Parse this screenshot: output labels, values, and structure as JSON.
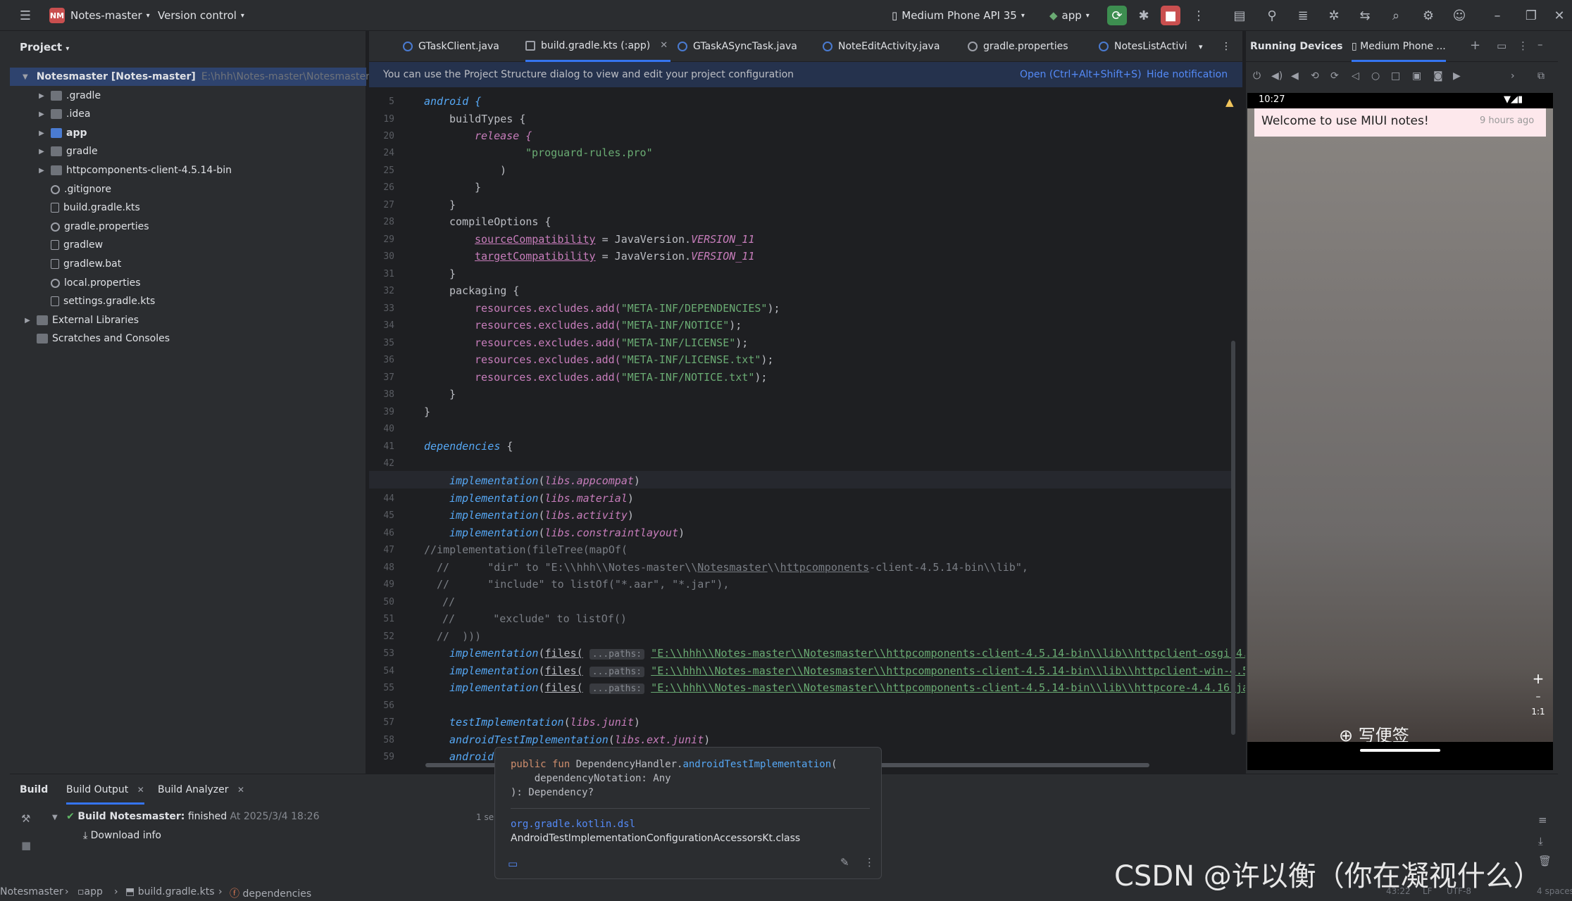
{
  "titlebar": {
    "project": "Notes-master",
    "project_badge": "NM",
    "vcs": "Version control",
    "device": "Medium Phone API 35",
    "run_config": "app"
  },
  "project_panel": {
    "title": "Project",
    "items": [
      {
        "label": "Notesmaster [Notes-master]",
        "hint": "E:\\hhh\\Notes-master\\Notesmaster"
      },
      {
        "label": ".gradle"
      },
      {
        "label": ".idea"
      },
      {
        "label": "app"
      },
      {
        "label": "gradle"
      },
      {
        "label": "httpcomponents-client-4.5.14-bin"
      },
      {
        "label": ".gitignore"
      },
      {
        "label": "build.gradle.kts"
      },
      {
        "label": "gradle.properties"
      },
      {
        "label": "gradlew"
      },
      {
        "label": "gradlew.bat"
      },
      {
        "label": "local.properties"
      },
      {
        "label": "settings.gradle.kts"
      },
      {
        "label": "External Libraries"
      },
      {
        "label": "Scratches and Consoles"
      }
    ]
  },
  "tabs": [
    {
      "label": "GTaskClient.java"
    },
    {
      "label": "build.gradle.kts (:app)"
    },
    {
      "label": "GTaskASyncTask.java"
    },
    {
      "label": "NoteEditActivity.java"
    },
    {
      "label": "gradle.properties"
    },
    {
      "label": "NotesListActivi"
    }
  ],
  "notification": {
    "text": "You can use the Project Structure dialog to view and edit your project configuration",
    "open": "Open (Ctrl+Alt+Shift+S)",
    "hide": "Hide notification"
  },
  "line_numbers": [
    "5",
    "19",
    "20",
    "24",
    "25",
    "26",
    "27",
    "28",
    "29",
    "30",
    "31",
    "32",
    "33",
    "34",
    "35",
    "36",
    "37",
    "38",
    "39",
    "40",
    "41",
    "42",
    "43",
    "44",
    "45",
    "46",
    "47",
    "48",
    "49",
    "50",
    "51",
    "52",
    "53",
    "54",
    "55",
    "56",
    "57",
    "58",
    "59"
  ],
  "code": {
    "c5": "android {",
    "c19": "buildTypes {",
    "c20": "release {",
    "c24": "\"proguard-rules.pro\"",
    "c25": ")",
    "c26": "}",
    "c27": "}",
    "c28": "compileOptions {",
    "c29a": "sourceCompatibility",
    "c29b": " = JavaVersion.",
    "c29c": "VERSION_11",
    "c30a": "targetCompatibility",
    "c30b": " = JavaVersion.",
    "c30c": "VERSION_11",
    "c31": "}",
    "c32": "packaging {",
    "res": "resources.excludes.add(",
    "c33s": "\"META-INF/DEPENDENCIES\"",
    "c34s": "\"META-INF/NOTICE\"",
    "c35s": "\"META-INF/LICENSE\"",
    "c36s": "\"META-INF/LICENSE.txt\"",
    "c37s": "\"META-INF/NOTICE.txt\"",
    "close": ");",
    "c38": "}",
    "c39": "}",
    "c41": "dependencies",
    "c41b": " {",
    "impl": "implementation",
    "c43": "libs.appcompat",
    "c44": "libs.material",
    "c45": "libs.activity",
    "c46": "libs.constraintlayout",
    "c47": "//implementation(fileTree(mapOf(",
    "c48a": "//      \"dir\" to \"E:\\\\hhh\\\\Notes-master\\\\",
    "c48b": "Notesmaster",
    "c48c": "\\\\",
    "c48d": "httpcomponents",
    "c48e": "-client-4.5.14-bin\\\\lib\",",
    "c49": "//      \"include\" to listOf(\"*.aar\", \"*.jar\"),",
    "c50": "//",
    "c51": "//      \"exclude\" to listOf()",
    "c52": "//  )))",
    "files": "files(",
    "paths": "...paths:",
    "c53": "\"E:\\\\hhh\\\\Notes-master\\\\Notesmaster\\\\httpcomponents-client-4.5.14-bin\\\\lib\\\\httpclient-osgi-4.5.",
    "c54": "\"E:\\\\hhh\\\\Notes-master\\\\Notesmaster\\\\httpcomponents-client-4.5.14-bin\\\\lib\\\\httpclient-win-4.5.14",
    "c55": "\"E:\\\\hhh\\\\Notes-master\\\\Notesmaster\\\\httpcomponents-client-4.5.14-bin\\\\lib\\\\httpcore-4.4.16.jar\")",
    "c57a": "testImplementation",
    "c57b": "libs.junit",
    "c58a": "androidTestImplementation",
    "c58b": "libs.ext.junit",
    "c59": "android"
  },
  "devices": {
    "title": "Running Devices",
    "tab": "Medium Phone ...",
    "time": "10:27",
    "notification_title": "Welcome to use MIUI notes!",
    "notification_time": "9 hours ago",
    "new_note": "写便签",
    "zoom": "1:1"
  },
  "build": {
    "tabs": [
      "Build",
      "Build Output",
      "Build Analyzer"
    ],
    "result": "Build Notesmaster:",
    "result_status": "finished",
    "result_time": "At 2025/3/4 18:26",
    "duration": "1 se",
    "download": "Download info"
  },
  "popup": {
    "line1a": "public fun ",
    "line1b": "DependencyHandler.",
    "line1c": "androidTestImplementation",
    "line1d": "(",
    "line2": "    dependencyNotation: Any",
    "line3": "): Dependency?",
    "package": "org.gradle.kotlin.dsl",
    "class": "AndroidTestImplementationConfigurationAccessorsKt.class"
  },
  "breadcrumb": [
    "Notesmaster",
    "app",
    "build.gradle.kts",
    "dependencies"
  ],
  "statusbar": {
    "pos": "43:22",
    "eol": "LF",
    "enc": "UTF-8",
    "indent": "4 spaces"
  },
  "watermark": "CSDN @许以衡（你在凝视什么）"
}
